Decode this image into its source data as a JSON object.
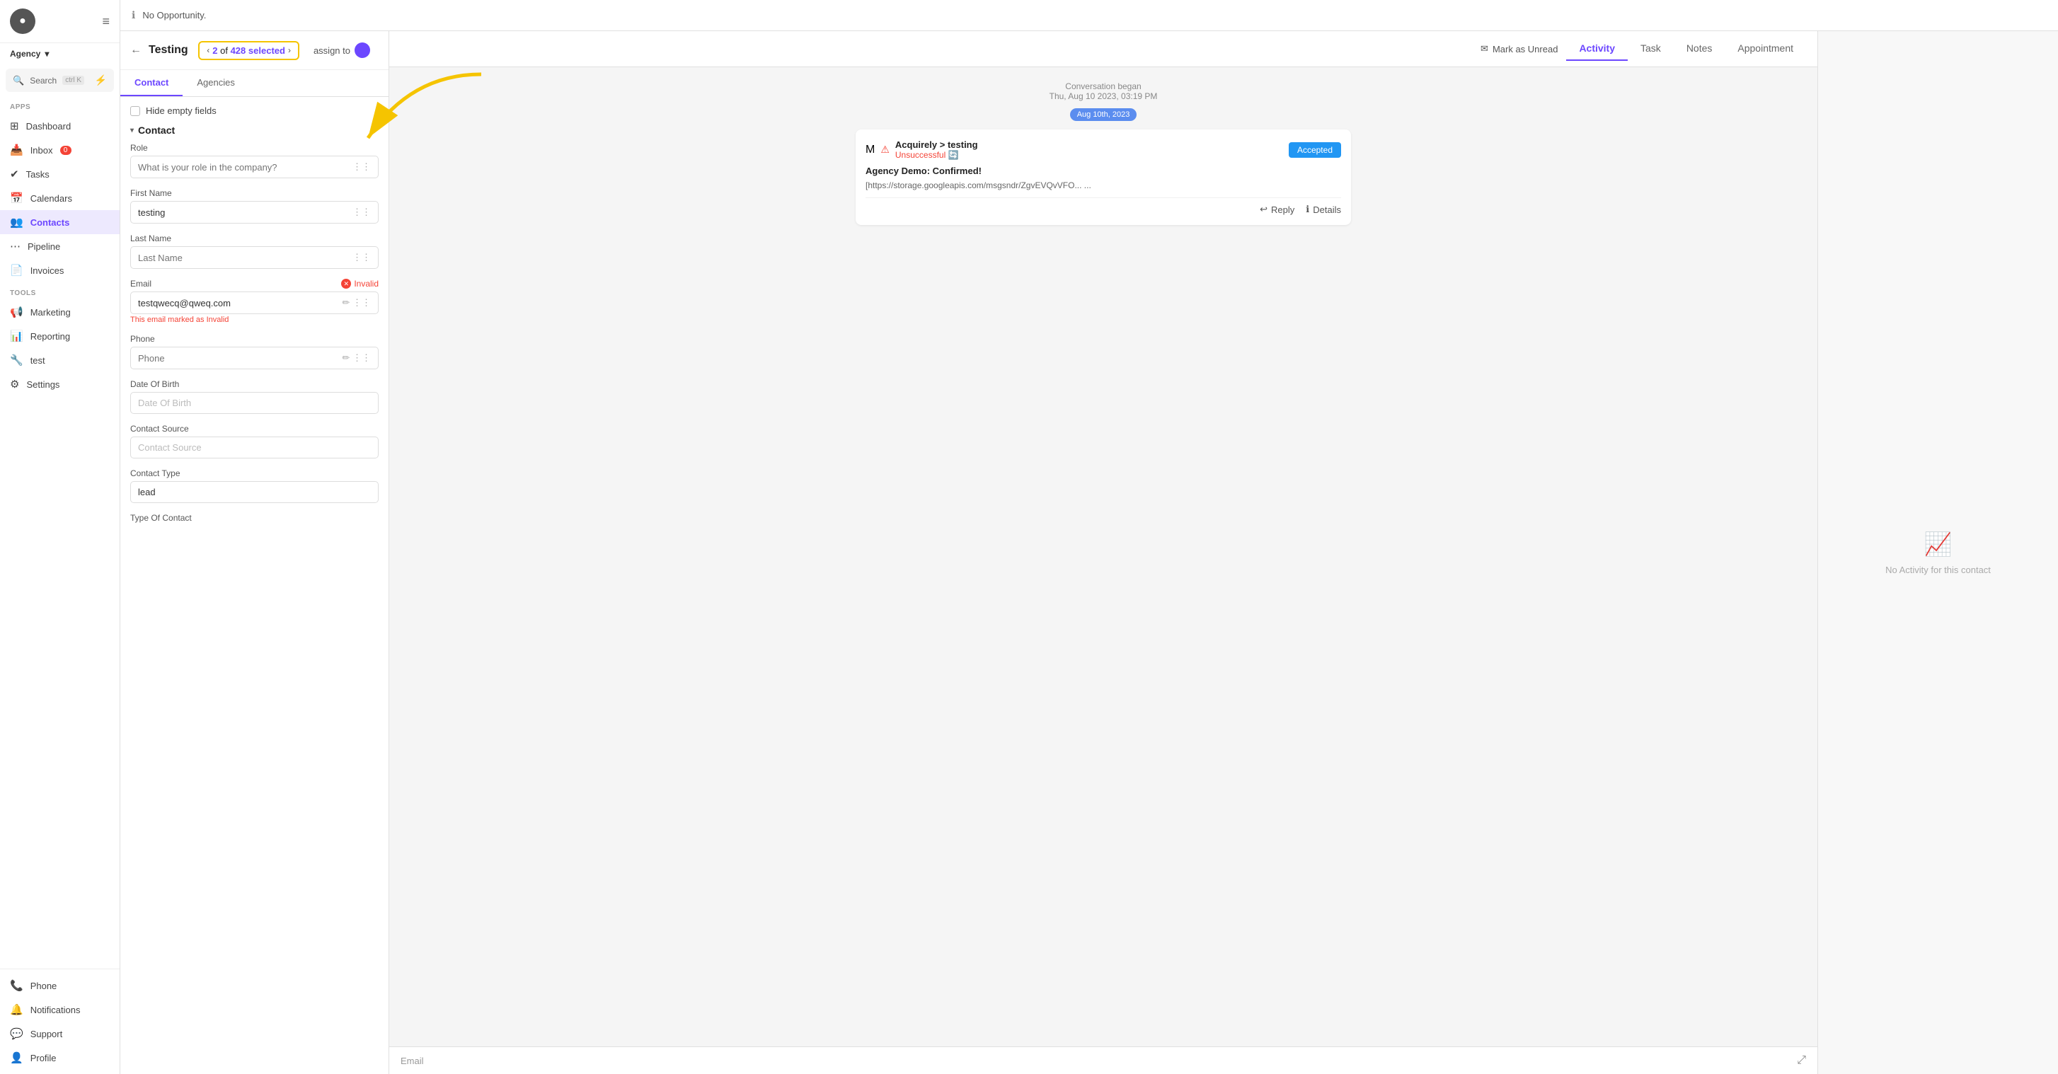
{
  "sidebar": {
    "brand": "Agency",
    "search_label": "Search",
    "search_kbd": "ctrl K",
    "apps_label": "Apps",
    "tools_label": "Tools",
    "items": [
      {
        "id": "dashboard",
        "label": "Dashboard",
        "icon": "⊞",
        "active": false
      },
      {
        "id": "inbox",
        "label": "Inbox",
        "icon": "📥",
        "active": false,
        "badge": "0"
      },
      {
        "id": "tasks",
        "label": "Tasks",
        "icon": "✔",
        "active": false
      },
      {
        "id": "calendars",
        "label": "Calendars",
        "icon": "📅",
        "active": false
      },
      {
        "id": "contacts",
        "label": "Contacts",
        "icon": "👥",
        "active": true
      },
      {
        "id": "pipeline",
        "label": "Pipeline",
        "icon": "⋯",
        "active": false
      },
      {
        "id": "invoices",
        "label": "Invoices",
        "icon": "📄",
        "active": false
      },
      {
        "id": "marketing",
        "label": "Marketing",
        "icon": "📢",
        "active": false
      },
      {
        "id": "reporting",
        "label": "Reporting",
        "icon": "📊",
        "active": false
      },
      {
        "id": "test",
        "label": "test",
        "icon": "🔧",
        "active": false
      },
      {
        "id": "settings",
        "label": "Settings",
        "icon": "⚙",
        "active": false
      }
    ],
    "bottom_items": [
      {
        "id": "phone",
        "label": "Phone",
        "icon": "📞"
      },
      {
        "id": "notifications",
        "label": "Notifications",
        "icon": "🔔"
      },
      {
        "id": "support",
        "label": "Support",
        "icon": "💬"
      },
      {
        "id": "profile",
        "label": "Profile",
        "icon": "👤"
      }
    ]
  },
  "topbar": {
    "icon": "ℹ",
    "title": "No Opportunity."
  },
  "contact_panel": {
    "back_label": "←",
    "contact_name": "Testing",
    "selection": {
      "prev_label": "‹",
      "next_label": "›",
      "current": "2",
      "total": "428",
      "selected_label": "selected"
    },
    "assign_label": "assign to",
    "tabs": [
      {
        "id": "contact",
        "label": "Contact",
        "active": true
      },
      {
        "id": "agencies",
        "label": "Agencies",
        "active": false
      }
    ],
    "hide_empty_label": "Hide empty fields",
    "section_label": "Contact",
    "fields": {
      "role": {
        "label": "Role",
        "placeholder": "What is your role in the company?"
      },
      "first_name": {
        "label": "First Name",
        "value": "testing"
      },
      "last_name": {
        "label": "Last Name",
        "placeholder": "Last Name"
      },
      "email": {
        "label": "Email",
        "value": "testqwecq@qweq.com",
        "invalid": true,
        "invalid_label": "Invalid",
        "invalid_note": "This email marked as Invalid"
      },
      "phone": {
        "label": "Phone",
        "placeholder": "Phone"
      },
      "dob": {
        "label": "Date Of Birth",
        "placeholder": "Date Of Birth"
      },
      "contact_source": {
        "label": "Contact Source",
        "placeholder": "Contact Source"
      },
      "contact_type": {
        "label": "Contact Type",
        "value": "lead"
      },
      "type_of_contact": {
        "label": "Type Of Contact"
      }
    }
  },
  "conversation": {
    "mark_unread_label": "Mark as Unread",
    "tabs": [
      {
        "id": "activity",
        "label": "Activity",
        "active": true
      },
      {
        "id": "task",
        "label": "Task",
        "active": false
      },
      {
        "id": "notes",
        "label": "Notes",
        "active": false
      },
      {
        "id": "appointment",
        "label": "Appointment",
        "active": false
      }
    ],
    "conversation_began": "Conversation began",
    "conversation_date": "Thu, Aug 10 2023, 03:19 PM",
    "date_chip": "Aug 10th, 2023",
    "message": {
      "from_label": "Acquirely > testing",
      "status_label": "Unsuccessful",
      "subject": "Agency Demo: Confirmed!",
      "body": "[https://storage.googleapis.com/msgsndr/ZgvEVQvVFO...\n...",
      "accepted_label": "Accepted",
      "reply_label": "Reply",
      "details_label": "Details"
    },
    "email_placeholder": "Email",
    "expand_icon": "⤢"
  },
  "right_panel": {
    "no_activity_label": "No Activity for this contact"
  },
  "shield_badge": "🛡"
}
